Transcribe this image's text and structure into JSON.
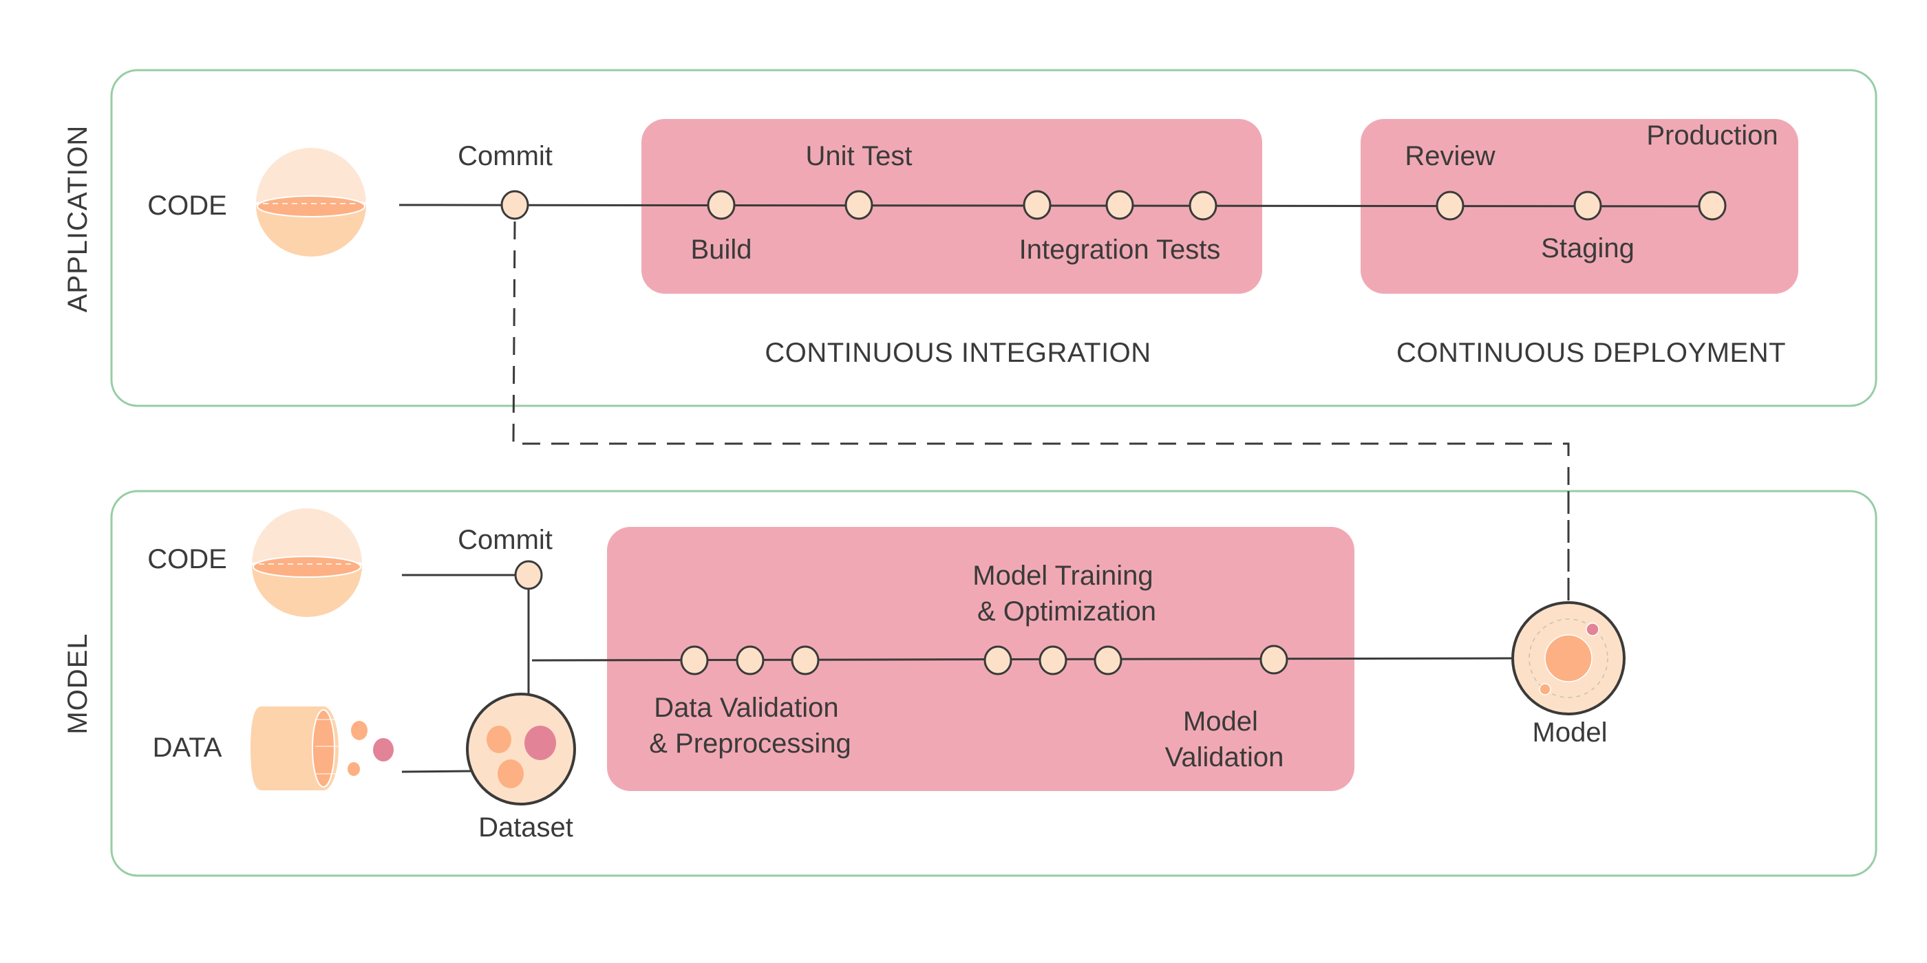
{
  "colors": {
    "section_border": "#96CDA5",
    "stage_box": "#F0A9B4",
    "node_fill": "#FCE1C8",
    "line": "#3a3a3a",
    "peach_light": "#FEE6D4",
    "peach": "#FDD3AC",
    "peach_dark": "#FDB083",
    "pink_dot": "#E38398"
  },
  "application": {
    "section_label": "APPLICATION",
    "code_label": "CODE",
    "commit_label": "Commit",
    "ci": {
      "title": "CONTINUOUS INTEGRATION",
      "labels": {
        "build": "Build",
        "unit_test": "Unit Test",
        "integration_tests": "Integration Tests"
      }
    },
    "cd": {
      "title": "CONTINUOUS DEPLOYMENT",
      "labels": {
        "review": "Review",
        "staging": "Staging",
        "production": "Production"
      }
    }
  },
  "model": {
    "section_label": "MODEL",
    "code_label": "CODE",
    "data_label": "DATA",
    "commit_label": "Commit",
    "dataset_label": "Dataset",
    "model_label": "Model",
    "stages": {
      "data_validation": [
        "Data Validation",
        "& Preprocessing"
      ],
      "model_training": [
        "Model Training",
        "& Optimization"
      ],
      "model_validation": [
        "Model",
        "Validation"
      ]
    }
  }
}
